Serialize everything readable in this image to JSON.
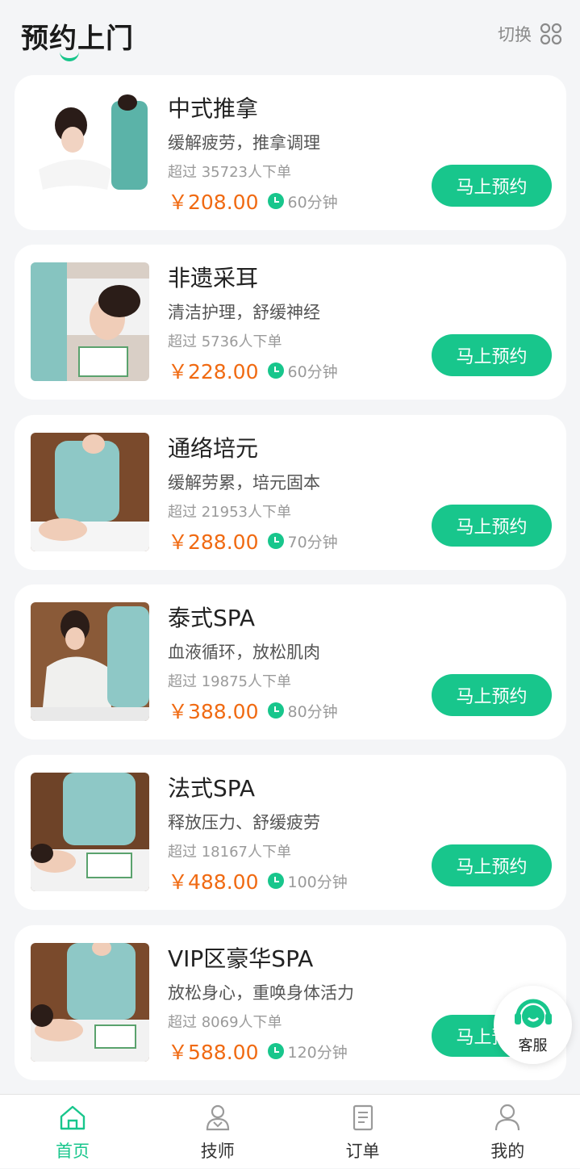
{
  "header": {
    "title": "预约上门",
    "switch_label": "切换"
  },
  "colors": {
    "accent": "#18c68c",
    "price": "#f06a12",
    "background": "#f4f5f7"
  },
  "services": [
    {
      "name": "中式推拿",
      "desc": "缓解疲劳，推拿调理",
      "orders": "超过 35723人下单",
      "price": "￥208.00",
      "duration": "60分钟",
      "button": "马上预约"
    },
    {
      "name": "非遗采耳",
      "desc": "清洁护理，舒缓神经",
      "orders": "超过 5736人下单",
      "price": "￥228.00",
      "duration": "60分钟",
      "button": "马上预约"
    },
    {
      "name": "通络培元",
      "desc": "缓解劳累，培元固本",
      "orders": "超过 21953人下单",
      "price": "￥288.00",
      "duration": "70分钟",
      "button": "马上预约"
    },
    {
      "name": "泰式SPA",
      "desc": "血液循环，放松肌肉",
      "orders": "超过 19875人下单",
      "price": "￥388.00",
      "duration": "80分钟",
      "button": "马上预约"
    },
    {
      "name": "法式SPA",
      "desc": "释放压力、舒缓疲劳",
      "orders": "超过 18167人下单",
      "price": "￥488.00",
      "duration": "100分钟",
      "button": "马上预约"
    },
    {
      "name": "VIP区豪华SPA",
      "desc": "放松身心，重唤身体活力",
      "orders": "超过 8069人下单",
      "price": "￥588.00",
      "duration": "120分钟",
      "button": "马上预约"
    }
  ],
  "customer_service": {
    "label": "客服",
    "icon": "headset-icon"
  },
  "tabbar": {
    "items": [
      {
        "label": "首页",
        "icon": "home-icon",
        "active": true
      },
      {
        "label": "技师",
        "icon": "technician-icon",
        "active": false
      },
      {
        "label": "订单",
        "icon": "order-icon",
        "active": false
      },
      {
        "label": "我的",
        "icon": "profile-icon",
        "active": false
      }
    ]
  }
}
